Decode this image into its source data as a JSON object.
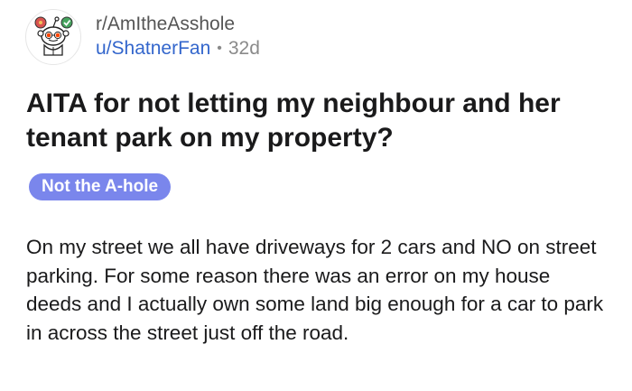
{
  "post": {
    "subreddit": "r/AmItheAsshole",
    "author": "u/ShatnerFan",
    "separator": "•",
    "age": "32d",
    "avatar_icon": "snoo-judge-icon",
    "title": "AITA for not letting my neighbour and her tenant park on my property?",
    "flair": "Not the A-hole",
    "body": "On my street we all have driveways for 2 cars and NO on street parking. For some reason there was an error on my house deeds and I actually own some land big enough for a car to park in across the street just off the road."
  },
  "colors": {
    "flair_background": "#7a86ec",
    "username": "#3366cc",
    "muted_text": "#8a8a8a",
    "primary_text": "#1a1a1b"
  }
}
